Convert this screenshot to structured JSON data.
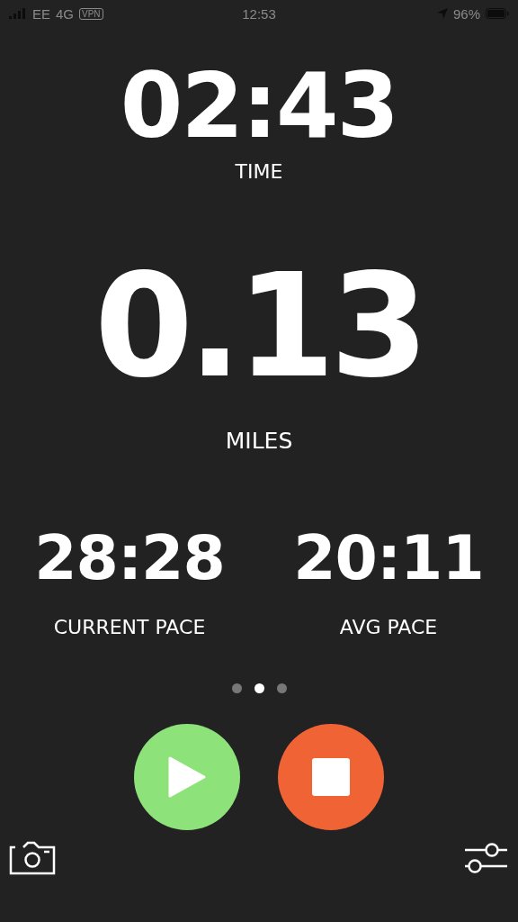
{
  "status_bar": {
    "carrier": "EE",
    "network": "4G",
    "vpn": "VPN",
    "time": "12:53",
    "battery": "96%"
  },
  "time": {
    "value": "02:43",
    "label": "TIME"
  },
  "distance": {
    "value": "0.13",
    "label": "MILES"
  },
  "paces": [
    {
      "value": "28:28",
      "label": "CURRENT PACE"
    },
    {
      "value": "20:11",
      "label": "AVG PACE"
    }
  ],
  "pages": [
    {
      "selected": false
    },
    {
      "selected": true
    },
    {
      "selected": false
    }
  ]
}
